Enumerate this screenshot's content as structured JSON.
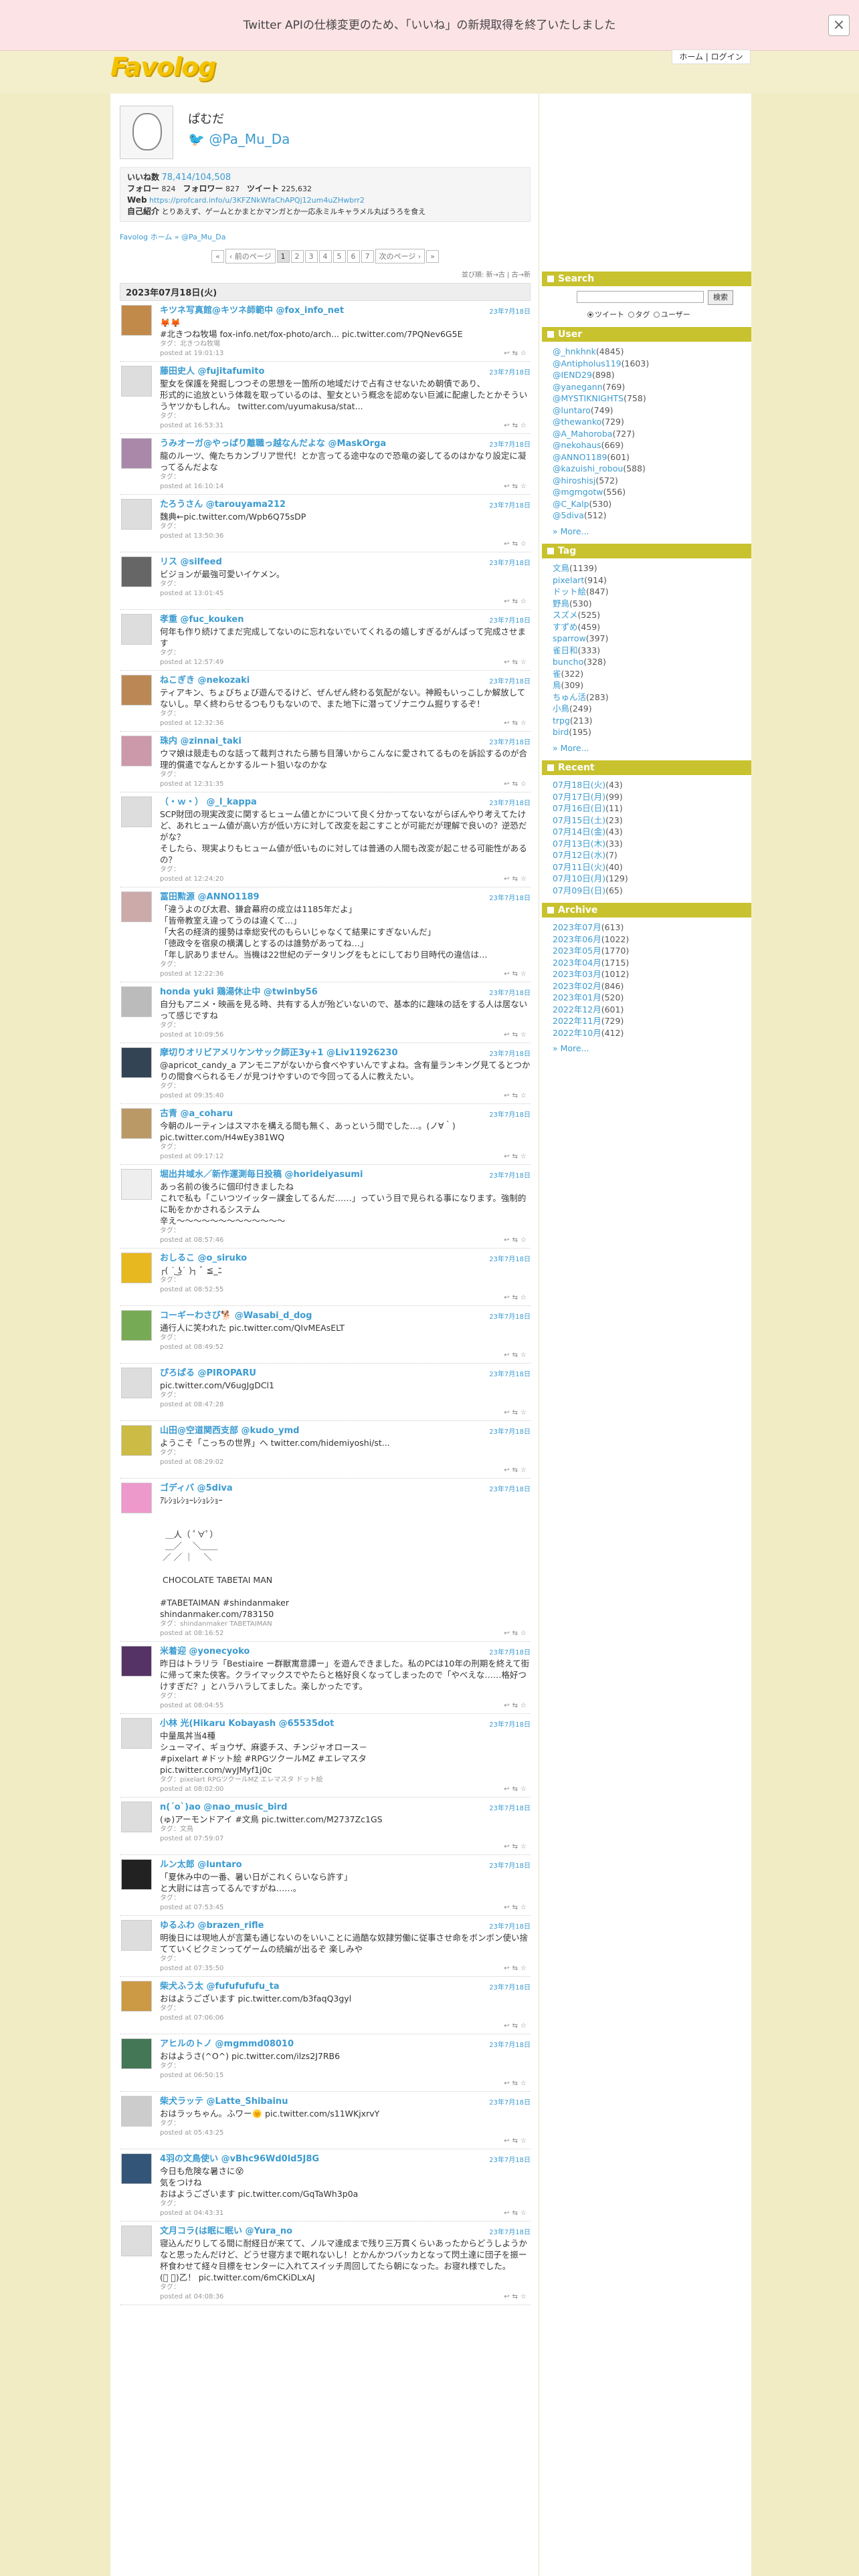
{
  "notice": {
    "text": "Twitter APIの仕様変更のため、「いいね」の新規取得を終了いたしました",
    "close": "×"
  },
  "header": {
    "logo": "Favolog",
    "links": "ホーム | ログイン"
  },
  "profile": {
    "name": "ぱむだ",
    "handle": "@Pa_Mu_Da",
    "likes_label": "いいね数",
    "likes": "78,414/104,508",
    "followers_label": "フォロー",
    "follow": "824",
    "follower_label": "フォロワー",
    "follower": "827",
    "tweets_label": "ツイート",
    "tweets": "225,632",
    "web_label": "Web",
    "web": "https://profcard.info/u/3KFZNkWfaChAPQj12um4uZHwbrr2",
    "bio_label": "自己紹介",
    "bio": "とりあえず、ゲームとかまとかマンガとか一応永ミルキャラメル丸ばうろを食え"
  },
  "breadcrumb": "Favolog ホーム » @Pa_Mu_Da",
  "pager": {
    "first": "«",
    "prev": "‹ 前のページ",
    "pages": [
      "1",
      "2",
      "3",
      "4",
      "5",
      "6",
      "7"
    ],
    "next": "次のページ ›",
    "last": "»"
  },
  "sort": "並び順: 新→古 | 古→新",
  "date_header": "2023年07月18日(火)",
  "tweets": [
    {
      "name": "キツネ写真館@キツネ師範中 @fox_info_net",
      "date": "23年7月18日",
      "body": "🦊🦊\n#北きつね牧場 fox-info.net/fox-photo/arch... pic.twitter.com/7PQNev6G5E",
      "tags": "タグ：北きつね牧場",
      "posted": "posted at 19:01:13",
      "color": "#c28a4a"
    },
    {
      "name": "藤田史人 @fujitafumito",
      "date": "23年7月18日",
      "body": "聖女を保護を発掘しつつその思想を一箇所の地域だけで占有させないため朝債であり、\n形式的に追放という体裁を取っているのは、聖女という概念を認めない巨滅に配慮したとかそういうヤツかもしれん。 twitter.com/uyumakusa/stat...",
      "tags": "タグ：",
      "posted": "posted at 16:53:31",
      "color": "#ddd"
    },
    {
      "name": "うみオーガ@やっぱり離職っ越なんだよな @MaskOrga",
      "date": "23年7月18日",
      "body": "龍のルーツ、俺たちカンブリア世代！とか言ってる途中なので恐竜の姿してるのはかなり設定に凝ってるんだよな",
      "tags": "タグ：",
      "posted": "posted at 16:10:14",
      "color": "#a8a"
    },
    {
      "name": "たろうさん @tarouyama212",
      "date": "23年7月18日",
      "body": "魏典←pic.twitter.com/Wpb6Q75sDP",
      "tags": "タグ：",
      "posted": "posted at 13:50:36",
      "color": "#ddd"
    },
    {
      "name": "リス @silfeed",
      "date": "23年7月18日",
      "body": "ビジョンが最強可愛いイケメン。",
      "tags": "タグ：",
      "posted": "posted at 13:01:45",
      "color": "#666"
    },
    {
      "name": "孝重 @fuc_kouken",
      "date": "23年7月18日",
      "body": "何年も作り続けてまだ完成してないのに忘れないでいてくれるの嬉しすぎるがんばって完成させます",
      "tags": "タグ：",
      "posted": "posted at 12:57:49",
      "color": "#ddd"
    },
    {
      "name": "ねこぎき @nekozaki",
      "date": "23年7月18日",
      "body": "ティアキン、ちょびちょび遊んでるけど、ぜんぜん終わる気配がない。神殿もいっこしか解放してないし。早く終わらせるつもりもないので、また地下に潜ってゾナニウム掘りするぞ！",
      "tags": "タグ：",
      "posted": "posted at 12:32:36",
      "color": "#b85"
    },
    {
      "name": "珠内 @zinnai_taki",
      "date": "23年7月18日",
      "body": "ウマ娘は競走ものな話って裁判されたら勝ち目薄いからこんなに愛されてるものを訴訟するのが合理的償遣でなんとかするルート狙いなのかな",
      "tags": "タグ：",
      "posted": "posted at 12:31:35",
      "color": "#c9a"
    },
    {
      "name": "（・ｗ・） @_l_kappa",
      "date": "23年7月18日",
      "body": "SCP財団の現実改変に関するヒューム値とかについて良く分かってないながらぼんやり考えてたけど、あれヒューム値が高い方が低い方に対して改変を起こすことが可能だが理解で良いの？逆恐だがな？\nそしたら、現実よりもヒューム値が低いものに対しては普通の人間も改変が起こせる可能性があるの？",
      "tags": "タグ：",
      "posted": "posted at 12:24:20",
      "color": "#ddd"
    },
    {
      "name": "冨田勲源 @ANNO1189",
      "date": "23年7月18日",
      "body": "「違うよのび太君、鎌倉幕府の成立は1185年だよ」\n「皆帝教室え違ってうのは違くて…」\n「大名の経済的援勢は幸総安代のもらいじゃなくて結果にすぎないんだ」\n「徳政令を宿泉の横溝しとするのは誰勢があってね…」\n「年し訳ありません。当機は22世紀のデータリングをもとにしており目時代の違信は…",
      "tags": "タグ：",
      "posted": "posted at 12:22:36",
      "color": "#caa"
    },
    {
      "name": "honda yuki 鶏湯休止中 @twinby56",
      "date": "23年7月18日",
      "body": "自分もアニメ・映画を見る時、共有する人が殆どいないので、基本的に趣味の話をする人は居ないって感じですね",
      "tags": "タグ：",
      "posted": "posted at 10:09:56",
      "color": "#bbb"
    },
    {
      "name": "摩切りオリビアメリケンサック師正3y+1 @Liv11926230",
      "date": "23年7月18日",
      "body": "@apricot_candy_a アンモニアがないから食べやすいんですよね。含有量ランキング見てるとつかりの間食べられるモノが見つけやすいので今回ってる人に教えたい。",
      "tags": "タグ：",
      "posted": "posted at 09:35:40",
      "color": "#345"
    },
    {
      "name": "古青 @a_coharu",
      "date": "23年7月18日",
      "body": "今朝のルーティンはスマホを構える間も無く、あっという間でした…。(ノ∀｀)\npic.twitter.com/H4wEy381WQ",
      "tags": "タグ：",
      "posted": "posted at 09:17:12",
      "color": "#b96"
    },
    {
      "name": "堀出井域水／新作運測毎日投稿 @horideiyasumi",
      "date": "23年7月18日",
      "body": "あっ名前の後ろに個印付きましたね\nこれで私も「こいつツイッター課金してるんだ……」っていう目で見られる事になります。強制的に恥をかかされるシステム\n辛え〜〜〜〜〜〜〜〜〜〜〜〜〜",
      "tags": "タグ：",
      "posted": "posted at 08:57:46",
      "color": "#eee"
    },
    {
      "name": "おしるこ @o_siruko",
      "date": "23年7月18日",
      "body": "┌( ˙ ͜ʖ˙ )┐ ﾞ ≦_ﾆ",
      "tags": "タグ：",
      "posted": "posted at 08:52:55",
      "color": "#e8b820"
    },
    {
      "name": "コーギーわさび🐕 @Wasabi_d_dog",
      "date": "23年7月18日",
      "body": "通行人に笑われた pic.twitter.com/QIvMEAsELT",
      "tags": "タグ：",
      "posted": "posted at 08:49:52",
      "color": "#7a5"
    },
    {
      "name": "ぴろぱる @PIROPARU",
      "date": "23年7月18日",
      "body": "pic.twitter.com/V6ugJgDCl1",
      "tags": "タグ：",
      "posted": "posted at 08:47:28",
      "color": "#ddd"
    },
    {
      "name": "山田@空道関西支部 @kudo_ymd",
      "date": "23年7月18日",
      "body": "ようこそ「こっちの世界」へ twitter.com/hidemiyoshi/st...",
      "tags": "タグ：",
      "posted": "posted at 08:29:02",
      "color": "#cb4"
    },
    {
      "name": "ゴディバ @5diva",
      "date": "23年7月18日",
      "body": "ｱﾚｼｮﾚｼｮｰﾚｼｮﾚｼｮｰ\n\n \n  ＿人（ ﾟ∀ﾟ）\n  ＿／    ＼＿＿\n ／ ／ ｜    ＼\n\n CHOCOLATE TABETAI MAN\n\n#TABETAIMAN #shindanmaker\nshindanmaker.com/783150",
      "tags": "タグ：shindanmaker TABETAIMAN",
      "posted": "posted at 08:16:52",
      "color": "#e9c"
    },
    {
      "name": "米着迎 @yonecyoko",
      "date": "23年7月18日",
      "body": "昨日はトラリラ「Bestiaire ー群獣寓意譚ー」を遊んできました。私のPCは10年の刑期を終えて街に帰って来た侠客。クライマックスでやたらと格好良くなってしまったので「やべえな……格好つけすぎだ？」とハラハラしてました。楽しかったです。",
      "tags": "タグ：",
      "posted": "posted at 08:04:55",
      "color": "#536"
    },
    {
      "name": "小林 光(Hikaru Kobayash @65535dot",
      "date": "23年7月18日",
      "body": "中量風丼当4種\nシューマイ、ギョウザ、麻婆チス、チンジャオロース－\n#pixelart #ドット絵 #RPGツクールMZ #エレマスタ\npic.twitter.com/wyJMyf1j0c",
      "tags": "タグ：pixelart RPGツクールMZ エレマスタ ドット絵",
      "posted": "posted at 08:02:00",
      "color": "#ddd"
    },
    {
      "name": "n(´o`)ao @nao_music_bird",
      "date": "23年7月18日",
      "body": "(ゅ)アーモンドアイ #文鳥 pic.twitter.com/M2737Zc1GS",
      "tags": "タグ：文鳥",
      "posted": "posted at 07:59:07",
      "color": "#ddd"
    },
    {
      "name": "ルン太郎 @luntaro",
      "date": "23年7月18日",
      "body": "「夏休み中の一番、暑い日がこれくらいなら許す」\nと大尉には言ってるんですがね……。",
      "tags": "タグ：",
      "posted": "posted at 07:53:45",
      "color": "#222"
    },
    {
      "name": "ゆるふわ @brazen_rifle",
      "date": "23年7月18日",
      "body": "明後日には現地人が言葉も通じないのをいいことに過酷な奴隷労働に従事させ命をボンボン使い捨てていくビクミンってゲームの続編が出るぞ 楽しみや",
      "tags": "タグ：",
      "posted": "posted at 07:35:50",
      "color": "#ddd"
    },
    {
      "name": "柴犬ふう太 @fufufufufu_ta",
      "date": "23年7月18日",
      "body": "おはようございます pic.twitter.com/b3faqQ3gyl",
      "tags": "タグ：",
      "posted": "posted at 07:06:06",
      "color": "#c94"
    },
    {
      "name": "アヒルのトノ @mgmmd08010",
      "date": "23年7月18日",
      "body": "おはようさ(^O^) pic.twitter.com/ilzs2J7RB6",
      "tags": "タグ：",
      "posted": "posted at 06:50:15",
      "color": "#475"
    },
    {
      "name": "柴犬ラッテ @Latte_Shibainu",
      "date": "23年7月18日",
      "body": "おはラッちゃん。ふワー🌞 pic.twitter.com/s11WKjxrvY",
      "tags": "タグ：",
      "posted": "posted at 05:43:25",
      "color": "#ccc"
    },
    {
      "name": "4羽の文鳥使い @vBhc96Wd0ld5J8G",
      "date": "23年7月18日",
      "body": "今日も危険な暑さに😵\n気をつけね\nおはようございます pic.twitter.com/GqTaWh3p0a",
      "tags": "タグ：",
      "posted": "posted at 04:43:31",
      "color": "#357"
    },
    {
      "name": "文月コラ(は眠に眠い @Yura_no",
      "date": "23年7月18日",
      "body": "寝込んだりしてる間に耐経日が来てて、ノルマ達成まで残り三万貫くらいあったからどうしようかなと思ったんだけど、どうせ寝方まで眠れないし！とかんかつバッカとなって閃土達に団子を振ー杯食わせて経々目標をセンターに入れてスイッチ周回してたら朝になった。お寝れ様でした。\n(ﾟ ゜)乙！ pic.twitter.com/6mCKiDLxAJ",
      "tags": "タグ：",
      "posted": "posted at 04:08:36",
      "color": "#ddd"
    }
  ],
  "sidebar": {
    "search": {
      "title": "Search",
      "button": "検索",
      "opt_tweet": "ツイート",
      "opt_tag": "タグ",
      "opt_user": "ユーザー"
    },
    "user": {
      "title": "User",
      "items": [
        {
          "n": "@_hnkhnk",
          "c": "(4845)"
        },
        {
          "n": "@Antipholus119",
          "c": "(1603)"
        },
        {
          "n": "@IEND29",
          "c": "(898)"
        },
        {
          "n": "@yanegann",
          "c": "(769)"
        },
        {
          "n": "@MYSTIKNIGHTS",
          "c": "(758)"
        },
        {
          "n": "@luntaro",
          "c": "(749)"
        },
        {
          "n": "@thewanko",
          "c": "(729)"
        },
        {
          "n": "@A_Mahoroba",
          "c": "(727)"
        },
        {
          "n": "@nekohaus",
          "c": "(669)"
        },
        {
          "n": "@ANNO1189",
          "c": "(601)"
        },
        {
          "n": "@kazuishi_robou",
          "c": "(588)"
        },
        {
          "n": "@hiroshisj",
          "c": "(572)"
        },
        {
          "n": "@mgmgotw",
          "c": "(556)"
        },
        {
          "n": "@C_Kalp",
          "c": "(530)"
        },
        {
          "n": "@5diva",
          "c": "(512)"
        }
      ],
      "more": "» More..."
    },
    "tag": {
      "title": "Tag",
      "items": [
        {
          "n": "文鳥",
          "c": "(1139)"
        },
        {
          "n": "pixelart",
          "c": "(914)"
        },
        {
          "n": "ドット絵",
          "c": "(847)"
        },
        {
          "n": "野鳥",
          "c": "(530)"
        },
        {
          "n": "スズメ",
          "c": "(525)"
        },
        {
          "n": "すずめ",
          "c": "(459)"
        },
        {
          "n": "sparrow",
          "c": "(397)"
        },
        {
          "n": "雀日和",
          "c": "(333)"
        },
        {
          "n": "buncho",
          "c": "(328)"
        },
        {
          "n": "雀",
          "c": "(322)"
        },
        {
          "n": "鳥",
          "c": "(309)"
        },
        {
          "n": "ちゅん活",
          "c": "(283)"
        },
        {
          "n": "小鳥",
          "c": "(249)"
        },
        {
          "n": "trpg",
          "c": "(213)"
        },
        {
          "n": "bird",
          "c": "(195)"
        }
      ],
      "more": "» More..."
    },
    "recent": {
      "title": "Recent",
      "items": [
        {
          "n": "07月18日(火)",
          "c": "(43)"
        },
        {
          "n": "07月17日(月)",
          "c": "(99)"
        },
        {
          "n": "07月16日(日)",
          "c": "(11)"
        },
        {
          "n": "07月15日(土)",
          "c": "(23)"
        },
        {
          "n": "07月14日(金)",
          "c": "(43)"
        },
        {
          "n": "07月13日(木)",
          "c": "(33)"
        },
        {
          "n": "07月12日(水)",
          "c": "(7)"
        },
        {
          "n": "07月11日(火)",
          "c": "(40)"
        },
        {
          "n": "07月10日(月)",
          "c": "(129)"
        },
        {
          "n": "07月09日(日)",
          "c": "(65)"
        }
      ]
    },
    "archive": {
      "title": "Archive",
      "items": [
        {
          "n": "2023年07月",
          "c": "(613)"
        },
        {
          "n": "2023年06月",
          "c": "(1022)"
        },
        {
          "n": "2023年05月",
          "c": "(1770)"
        },
        {
          "n": "2023年04月",
          "c": "(1715)"
        },
        {
          "n": "2023年03月",
          "c": "(1012)"
        },
        {
          "n": "2023年02月",
          "c": "(846)"
        },
        {
          "n": "2023年01月",
          "c": "(520)"
        },
        {
          "n": "2022年12月",
          "c": "(601)"
        },
        {
          "n": "2022年11月",
          "c": "(729)"
        },
        {
          "n": "2022年10月",
          "c": "(412)"
        }
      ],
      "more": "» More..."
    }
  }
}
